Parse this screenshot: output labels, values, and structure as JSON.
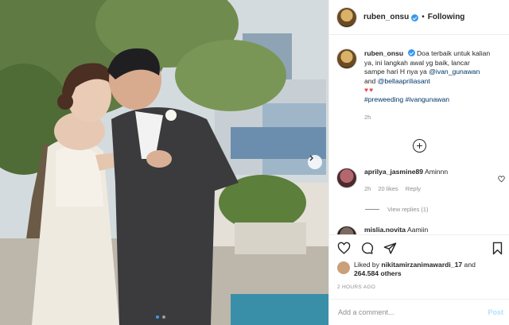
{
  "post": {
    "username": "ruben_onsu",
    "verified": true,
    "separator": "•",
    "follow_label": "Following"
  },
  "caption": {
    "username": "ruben_onsu",
    "text_1": "Doa terbaik untuk kalian ya, ini langkah awal yg baik, lancar sampe hari H nya ya",
    "mention_1": "@ivan_gunawan",
    "and_text": "and",
    "mention_2": "@bellaapriliasant",
    "hearts": "♥♥",
    "hashtag_1": "#preweeding",
    "hashtag_2": "#ivangunawan",
    "time": "2h"
  },
  "comments": [
    {
      "username": "aprilya_jasmine89",
      "text": "Aminnn",
      "time": "2h",
      "likes": "20 likes",
      "reply": "Reply",
      "view_replies": "View replies (1)"
    },
    {
      "username": "mislia.novita",
      "text": "Aamiin"
    }
  ],
  "likes": {
    "prefix": "Liked by",
    "user": "nikitamirzanimawardi_17",
    "and": "and",
    "count": "264.584 others"
  },
  "posted": "2 HOURS AGO",
  "add_comment": {
    "placeholder": "Add a comment...",
    "post_label": "Post"
  },
  "carousel": {
    "slides": 2,
    "active_index": 0
  },
  "icons": [
    "heart-icon",
    "comment-icon",
    "share-icon",
    "bookmark-icon",
    "add-circle-icon",
    "chevron-right-icon"
  ],
  "colors": {
    "accent": "#3897f0",
    "text": "#262626",
    "muted": "#8e8e8e",
    "heart": "#ed4956"
  }
}
